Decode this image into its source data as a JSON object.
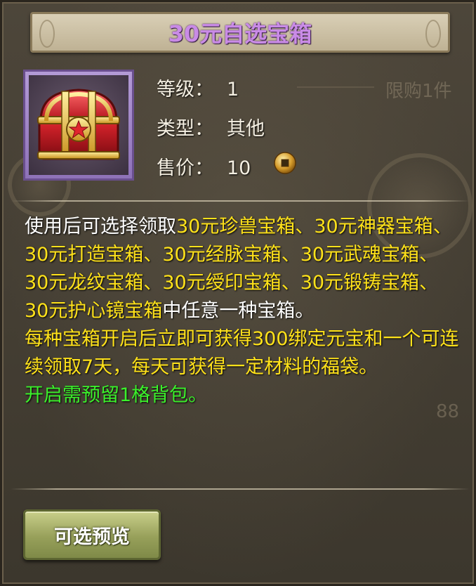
{
  "title": "30元自选宝箱",
  "background": {
    "limit_text": "限购1件",
    "price_text": "88"
  },
  "item": {
    "icon": "treasure-chest-icon",
    "level_label": "等级：",
    "level_value": "1",
    "type_label": "类型：",
    "type_value": "其他",
    "price_label": "售价：",
    "price_value": "10",
    "currency_icon": "copper-coin-icon"
  },
  "description": {
    "intro_prefix": "使用后可选择领取",
    "chest_list": "30元珍兽宝箱、30元神器宝箱、30元打造宝箱、30元经脉宝箱、30元武魂宝箱、30元龙纹宝箱、30元绶印宝箱、30元锻铸宝箱、30元护心镜宝箱",
    "intro_suffix": "中任意一种宝箱。",
    "reward_text": "每种宝箱开启后立即可获得300绑定元宝和一个可连续领取7天，每天可获得一定材料的福袋。",
    "notice_text": "开启需预留1格背包。"
  },
  "buttons": {
    "preview_label": "可选预览"
  },
  "colors": {
    "title": "#c98be6",
    "highlight": "#ffe21a",
    "notice": "#3bf02b",
    "button": "#97a05a"
  }
}
